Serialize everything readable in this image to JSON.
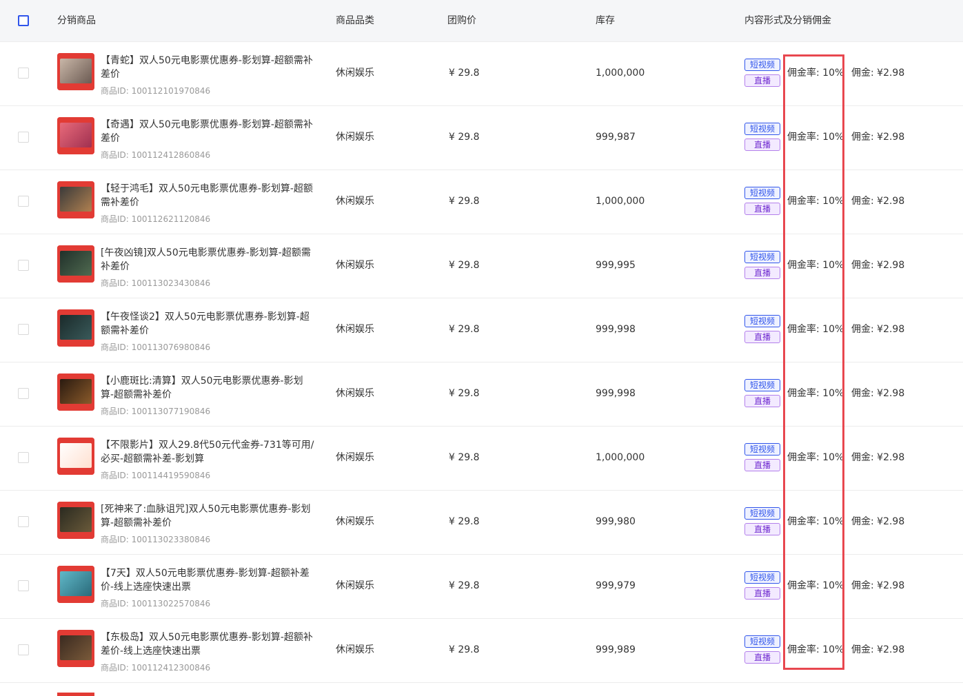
{
  "header": {
    "product": "分销商品",
    "category": "商品品类",
    "price": "团购价",
    "stock": "库存",
    "content": "内容形式及分销佣金"
  },
  "colors": {
    "accent": "#2f54eb",
    "highlight": "#e8474f",
    "live": "#722ed1"
  },
  "rows": [
    {
      "title": "【青蛇】双人50元电影票优惠券-影划算-超额需补差价",
      "id": "商品ID: 100112101970846",
      "category": "休闲娱乐",
      "price": "¥ 29.8",
      "stock": "1,000,000",
      "tag_video": "短视频",
      "tag_live": "直播",
      "rate": "佣金率: 10%",
      "commission": "佣金: ¥2.98"
    },
    {
      "title": "【奇遇】双人50元电影票优惠券-影划算-超额需补差价",
      "id": "商品ID: 100112412860846",
      "category": "休闲娱乐",
      "price": "¥ 29.8",
      "stock": "999,987",
      "tag_video": "短视频",
      "tag_live": "直播",
      "rate": "佣金率: 10%",
      "commission": "佣金: ¥2.98"
    },
    {
      "title": "【轻于鸿毛】双人50元电影票优惠券-影划算-超额需补差价",
      "id": "商品ID: 100112621120846",
      "category": "休闲娱乐",
      "price": "¥ 29.8",
      "stock": "1,000,000",
      "tag_video": "短视频",
      "tag_live": "直播",
      "rate": "佣金率: 10%",
      "commission": "佣金: ¥2.98"
    },
    {
      "title": "[午夜凶镜]双人50元电影票优惠券-影划算-超额需补差价",
      "id": "商品ID: 100113023430846",
      "category": "休闲娱乐",
      "price": "¥ 29.8",
      "stock": "999,995",
      "tag_video": "短视频",
      "tag_live": "直播",
      "rate": "佣金率: 10%",
      "commission": "佣金: ¥2.98"
    },
    {
      "title": "【午夜怪谈2】双人50元电影票优惠券-影划算-超额需补差价",
      "id": "商品ID: 100113076980846",
      "category": "休闲娱乐",
      "price": "¥ 29.8",
      "stock": "999,998",
      "tag_video": "短视频",
      "tag_live": "直播",
      "rate": "佣金率: 10%",
      "commission": "佣金: ¥2.98"
    },
    {
      "title": "【小鹿斑比:清算】双人50元电影票优惠券-影划算-超额需补差价",
      "id": "商品ID: 100113077190846",
      "category": "休闲娱乐",
      "price": "¥ 29.8",
      "stock": "999,998",
      "tag_video": "短视频",
      "tag_live": "直播",
      "rate": "佣金率: 10%",
      "commission": "佣金: ¥2.98"
    },
    {
      "title": "【不限影片】双人29.8代50元代金券-731等可用/必买-超额需补差-影划算",
      "id": "商品ID: 100114419590846",
      "category": "休闲娱乐",
      "price": "¥ 29.8",
      "stock": "1,000,000",
      "tag_video": "短视频",
      "tag_live": "直播",
      "rate": "佣金率: 10%",
      "commission": "佣金: ¥2.98"
    },
    {
      "title": "[死神来了:血脉诅咒]双人50元电影票优惠券-影划算-超额需补差价",
      "id": "商品ID: 100113023380846",
      "category": "休闲娱乐",
      "price": "¥ 29.8",
      "stock": "999,980",
      "tag_video": "短视频",
      "tag_live": "直播",
      "rate": "佣金率: 10%",
      "commission": "佣金: ¥2.98"
    },
    {
      "title": "【7天】双人50元电影票优惠券-影划算-超额补差价-线上选座快速出票",
      "id": "商品ID: 100113022570846",
      "category": "休闲娱乐",
      "price": "¥ 29.8",
      "stock": "999,979",
      "tag_video": "短视频",
      "tag_live": "直播",
      "rate": "佣金率: 10%",
      "commission": "佣金: ¥2.98"
    },
    {
      "title": "【东极岛】双人50元电影票优惠券-影划算-超额补差价-线上选座快速出票",
      "id": "商品ID: 100112412300846",
      "category": "休闲娱乐",
      "price": "¥ 29.8",
      "stock": "999,989",
      "tag_video": "短视频",
      "tag_live": "直播",
      "rate": "佣金率: 10%",
      "commission": "佣金: ¥2.98"
    }
  ]
}
